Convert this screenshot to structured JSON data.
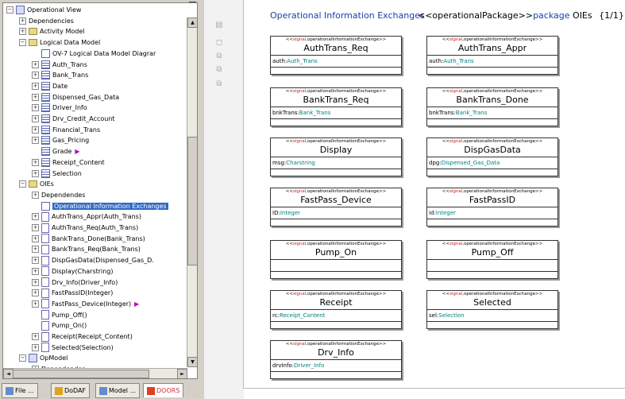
{
  "tree": {
    "items": [
      {
        "label": "Operational View",
        "indent": 0,
        "expand": "-",
        "icon": "pkg"
      },
      {
        "label": "Dependencies",
        "indent": 1,
        "expand": "+",
        "icon": "none"
      },
      {
        "label": "Activity Model",
        "indent": 1,
        "expand": "+",
        "icon": "folder"
      },
      {
        "label": "Logical Data Model",
        "indent": 1,
        "expand": "-",
        "icon": "folder"
      },
      {
        "label": "OV-7 Logical Data Model Diagrar",
        "indent": 2,
        "expand": "",
        "icon": "doc"
      },
      {
        "label": "Auth_Trans",
        "indent": 2,
        "expand": "+",
        "icon": "list"
      },
      {
        "label": "Bank_Trans",
        "indent": 2,
        "expand": "+",
        "icon": "list"
      },
      {
        "label": "Date",
        "indent": 2,
        "expand": "+",
        "icon": "list"
      },
      {
        "label": "Dispensed_Gas_Data",
        "indent": 2,
        "expand": "+",
        "icon": "list"
      },
      {
        "label": "Driver_Info",
        "indent": 2,
        "expand": "+",
        "icon": "list"
      },
      {
        "label": "Drv_Credit_Account",
        "indent": 2,
        "expand": "+",
        "icon": "list"
      },
      {
        "label": "Financial_Trans",
        "indent": 2,
        "expand": "+",
        "icon": "list"
      },
      {
        "label": "Gas_Pricing",
        "indent": 2,
        "expand": "+",
        "icon": "list"
      },
      {
        "label": "Grade",
        "indent": 2,
        "expand": "",
        "icon": "list",
        "marker": true
      },
      {
        "label": "Receipt_Content",
        "indent": 2,
        "expand": "+",
        "icon": "list"
      },
      {
        "label": "Selection",
        "indent": 2,
        "expand": "+",
        "icon": "list"
      },
      {
        "label": "OIEs",
        "indent": 1,
        "expand": "-",
        "icon": "folder"
      },
      {
        "label": "Dependendes",
        "indent": 2,
        "expand": "+",
        "icon": "none"
      },
      {
        "label": "Operational Information Exchanges",
        "indent": 2,
        "expand": "",
        "icon": "doc",
        "selected": true
      },
      {
        "label": "AuthTrans_Appr(Auth_Trans)",
        "indent": 2,
        "expand": "+",
        "icon": "sig"
      },
      {
        "label": "AuthTrans_Req(Auth_Trans)",
        "indent": 2,
        "expand": "+",
        "icon": "sig"
      },
      {
        "label": "BankTrans_Done(Bank_Trans)",
        "indent": 2,
        "expand": "+",
        "icon": "sig"
      },
      {
        "label": "BankTrans_Req(Bank_Trans)",
        "indent": 2,
        "expand": "+",
        "icon": "sig"
      },
      {
        "label": "DispGasData(Dispensed_Gas_D.",
        "indent": 2,
        "expand": "+",
        "icon": "sig"
      },
      {
        "label": "Display(Charstring)",
        "indent": 2,
        "expand": "+",
        "icon": "sig"
      },
      {
        "label": "Drv_Info(Driver_Info)",
        "indent": 2,
        "expand": "+",
        "icon": "sig"
      },
      {
        "label": "FastPassID(Integer)",
        "indent": 2,
        "expand": "+",
        "icon": "sig"
      },
      {
        "label": "FastPass_Device(Integer)",
        "indent": 2,
        "expand": "+",
        "icon": "sig",
        "marker": true
      },
      {
        "label": "Pump_Off()",
        "indent": 2,
        "expand": "",
        "icon": "sig"
      },
      {
        "label": "Pump_On()",
        "indent": 2,
        "expand": "",
        "icon": "sig"
      },
      {
        "label": "Receipt(Receipt_Content)",
        "indent": 2,
        "expand": "+",
        "icon": "sig"
      },
      {
        "label": "Selected(Selection)",
        "indent": 2,
        "expand": "+",
        "icon": "sig"
      },
      {
        "label": "OpModel",
        "indent": 1,
        "expand": "-",
        "icon": "pkg"
      },
      {
        "label": "Dependendes",
        "indent": 2,
        "expand": "+",
        "icon": "none"
      }
    ]
  },
  "tabs": [
    {
      "label": "File ...",
      "icon": "file-icon"
    },
    {
      "label": "DoDAF",
      "icon": "dodaf-icon"
    },
    {
      "label": "Model ...",
      "icon": "model-icon"
    },
    {
      "label": "DOORS",
      "icon": "doors-icon",
      "active": true
    }
  ],
  "header": {
    "title": "Operational Information Exchanges",
    "stereo": "<<operationalPackage>>",
    "pkg_kw": "package",
    "pkg_name": "OIEs",
    "page": "{1/1}"
  },
  "colors": {
    "title": "#1a3ea8",
    "keyword": "#c02020",
    "type": "#008080",
    "select": "#316ac5"
  },
  "stereo_parts": {
    "open": "<<",
    "kw": "signal",
    "rest": ",operationalInformationExchange",
    "close": ">>"
  },
  "boxes": [
    {
      "name": "AuthTrans_Req",
      "attr_name": "auth",
      "attr_type": "Auth_Trans"
    },
    {
      "name": "AuthTrans_Appr",
      "attr_name": "auth",
      "attr_type": "Auth_Trans"
    },
    {
      "name": "BankTrans_Req",
      "attr_name": "bnkTrans",
      "attr_type": "Bank_Trans"
    },
    {
      "name": "BankTrans_Done",
      "attr_name": "bnkTrans",
      "attr_type": "Bank_Trans"
    },
    {
      "name": "Display",
      "attr_name": "msg",
      "attr_type": "Charstring"
    },
    {
      "name": "DispGasData",
      "attr_name": "dpg",
      "attr_type": "Dispensed_Gas_Data"
    },
    {
      "name": "FastPass_Device",
      "attr_name": "ID",
      "attr_type": "Integer"
    },
    {
      "name": "FastPassID",
      "attr_name": "id",
      "attr_type": "Integer"
    },
    {
      "name": "Pump_On",
      "attr_name": "",
      "attr_type": ""
    },
    {
      "name": "Pump_Off",
      "attr_name": "",
      "attr_type": ""
    },
    {
      "name": "Receipt",
      "attr_name": "rc",
      "attr_type": "Receipt_Content"
    },
    {
      "name": "Selected",
      "attr_name": "sel",
      "attr_type": "Selection"
    },
    {
      "name": "Drv_Info",
      "attr_name": "drvInfo",
      "attr_type": "Driver_Info"
    }
  ]
}
